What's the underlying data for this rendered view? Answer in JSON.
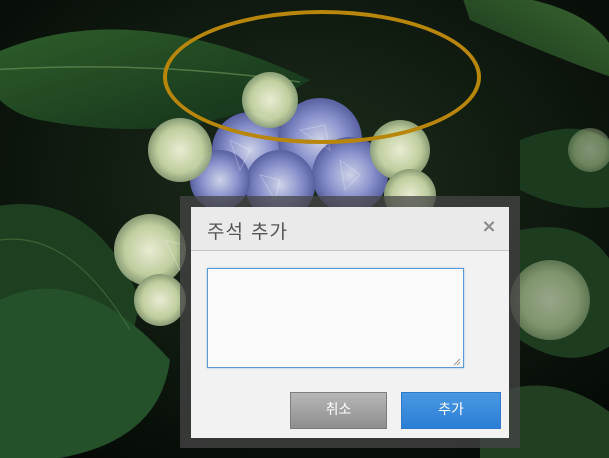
{
  "background": {
    "description_icon": "hydrangea-photo",
    "annotation_color": "#b8860b"
  },
  "dialog": {
    "title": "주석 추가",
    "close_glyph": "×",
    "textarea_value": "",
    "cancel_label": "취소",
    "add_label": "추가",
    "accent_color": "#2b7ed6"
  }
}
